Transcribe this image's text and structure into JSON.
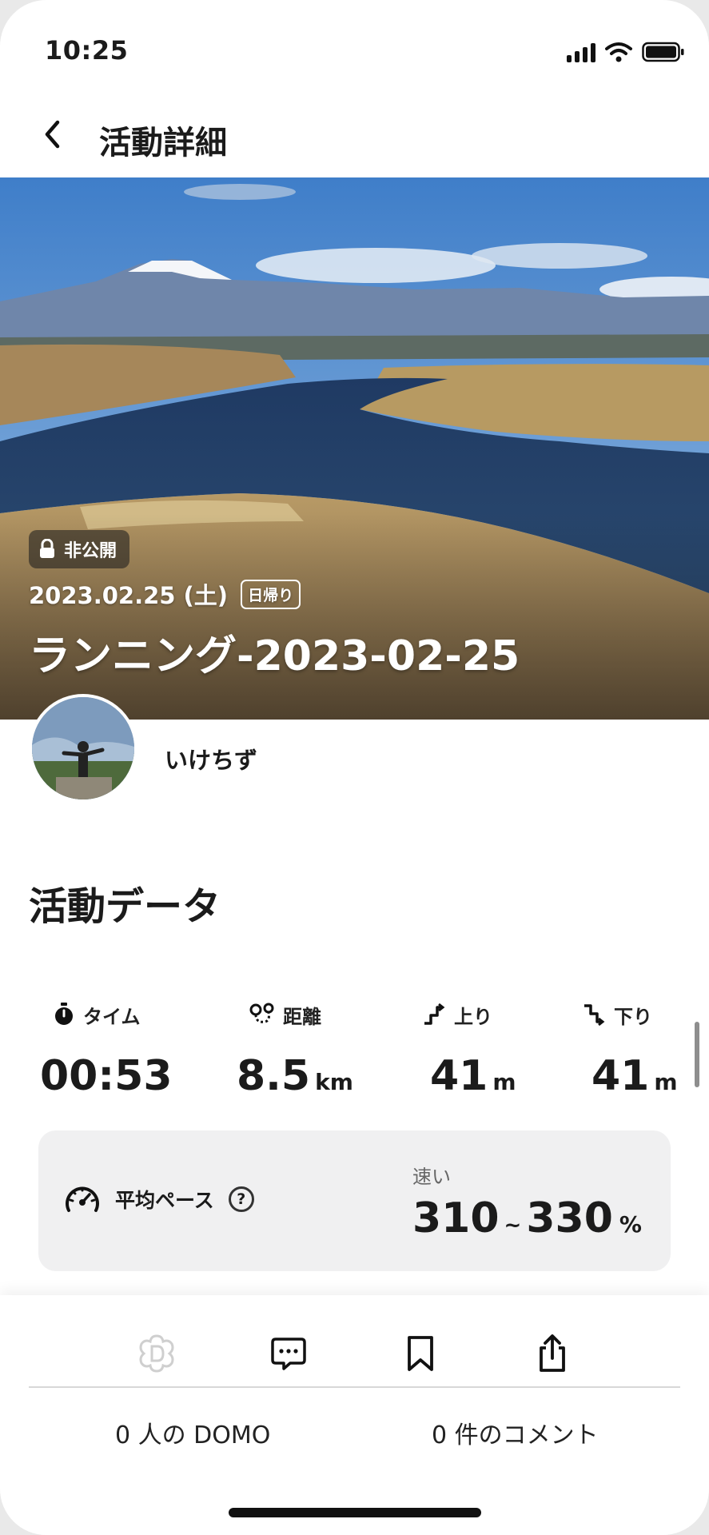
{
  "status_bar": {
    "time": "10:25"
  },
  "nav": {
    "title": "活動詳細",
    "back_icon": "chevron-left-icon"
  },
  "hero": {
    "privacy_label": "非公開",
    "date": "2023.02.25 (土)",
    "trip_type": "日帰り",
    "title": "ランニング-2023-02-25"
  },
  "user": {
    "name": "いけちず"
  },
  "activity": {
    "section_title": "活動データ",
    "stats": [
      {
        "label": "タイム",
        "value": "00:53",
        "unit": "",
        "icon": "stopwatch-icon"
      },
      {
        "label": "距離",
        "value": "8.5",
        "unit": "km",
        "icon": "route-icon"
      },
      {
        "label": "上り",
        "value": "41",
        "unit": "m",
        "icon": "ascent-icon"
      },
      {
        "label": "下り",
        "value": "41",
        "unit": "m",
        "icon": "descent-icon"
      }
    ],
    "pace": {
      "label": "平均ペース",
      "help": "?",
      "speed_label": "速い",
      "min": "310",
      "separator": "~",
      "max": "330",
      "unit": "%"
    }
  },
  "footer": {
    "actions": [
      "domo-icon",
      "comment-icon",
      "bookmark-icon",
      "share-icon"
    ],
    "domo_count": "0 人の DOMO",
    "comment_count": "0 件のコメント"
  },
  "colors": {
    "text": "#1b1b1b",
    "card": "#f0f0f1",
    "muted": "#666666",
    "domo_disabled": "#cfcfcf"
  }
}
